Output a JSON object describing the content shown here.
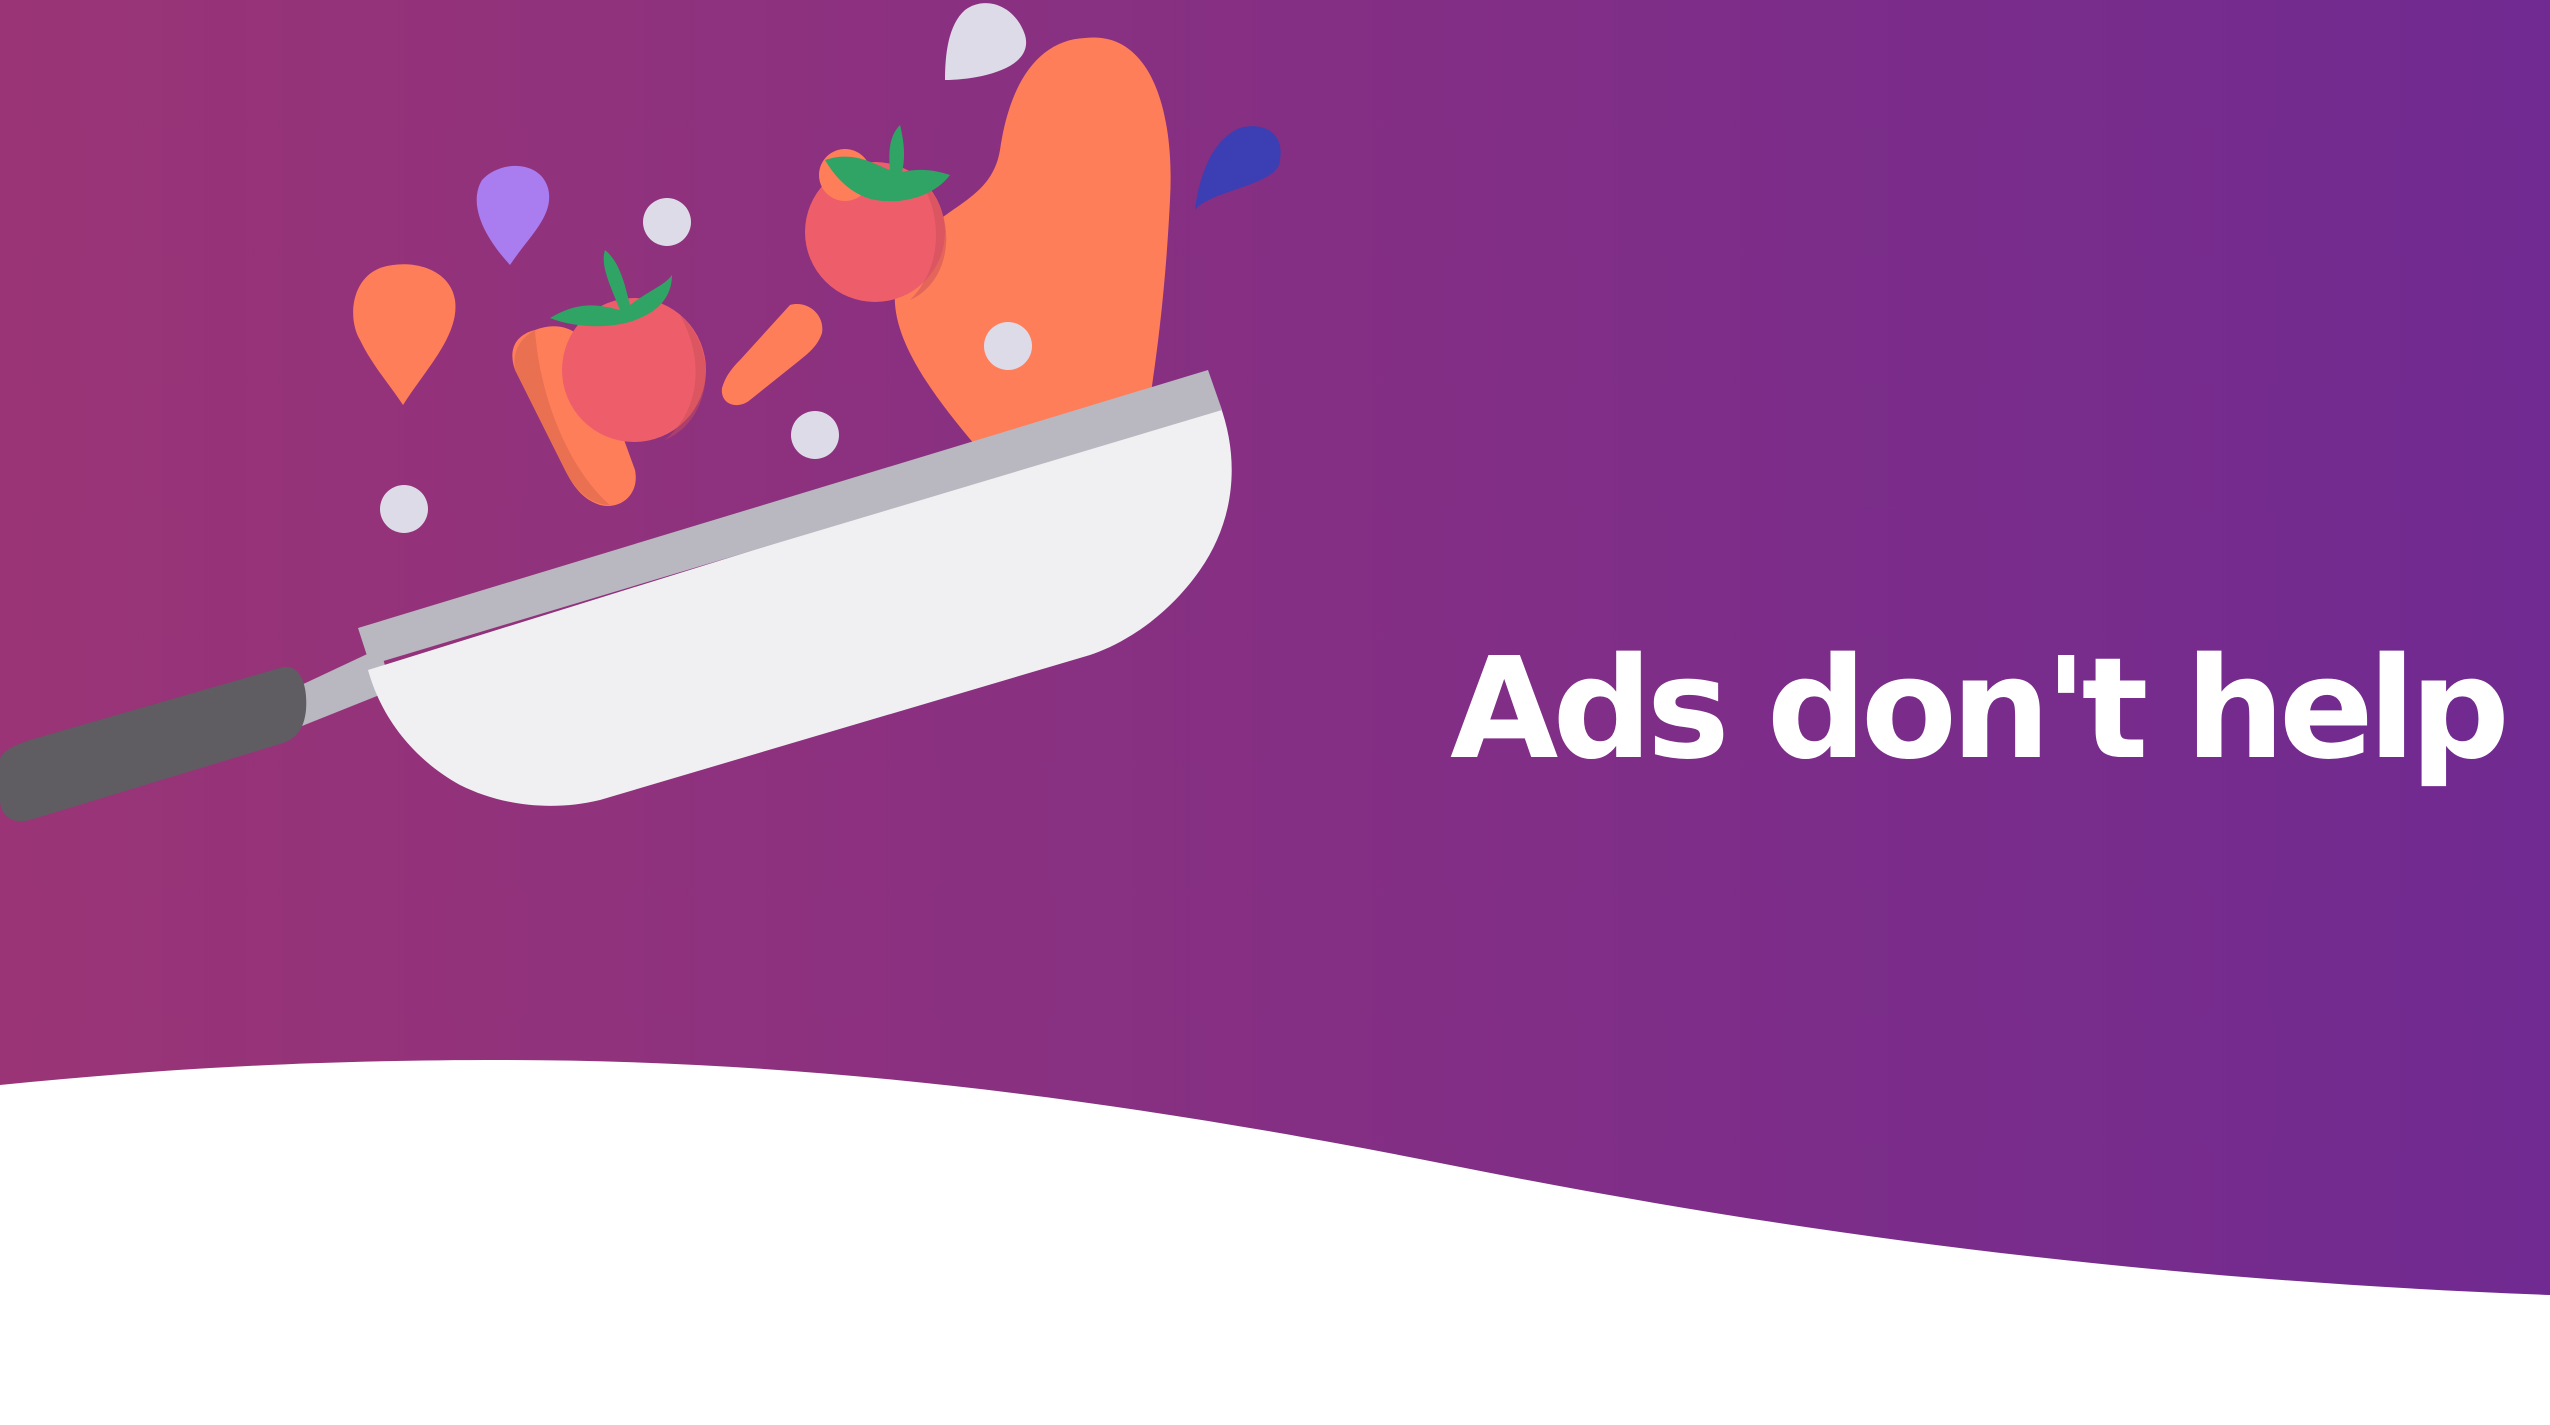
{
  "banner": {
    "headline": "Ads don't help",
    "colors": {
      "gradient_left": "#9a3476",
      "gradient_right": "#702a91",
      "background": "#ffffff",
      "pan_body": "#f0f0f2",
      "pan_rim": "#b9b7c0",
      "pan_handle": "#5f5d62",
      "carrot": "#ff7e5a",
      "tomato": "#ee5e6a",
      "tomato_leaf": "#2fa464",
      "drop_purple": "#a97cf0",
      "drop_blue": "#3b3fb3",
      "bubble": "#dedbe8"
    },
    "icons": [
      "frying-pan-icon",
      "tomato-icon",
      "carrot-icon",
      "drop-icon",
      "bubble-icon"
    ]
  }
}
